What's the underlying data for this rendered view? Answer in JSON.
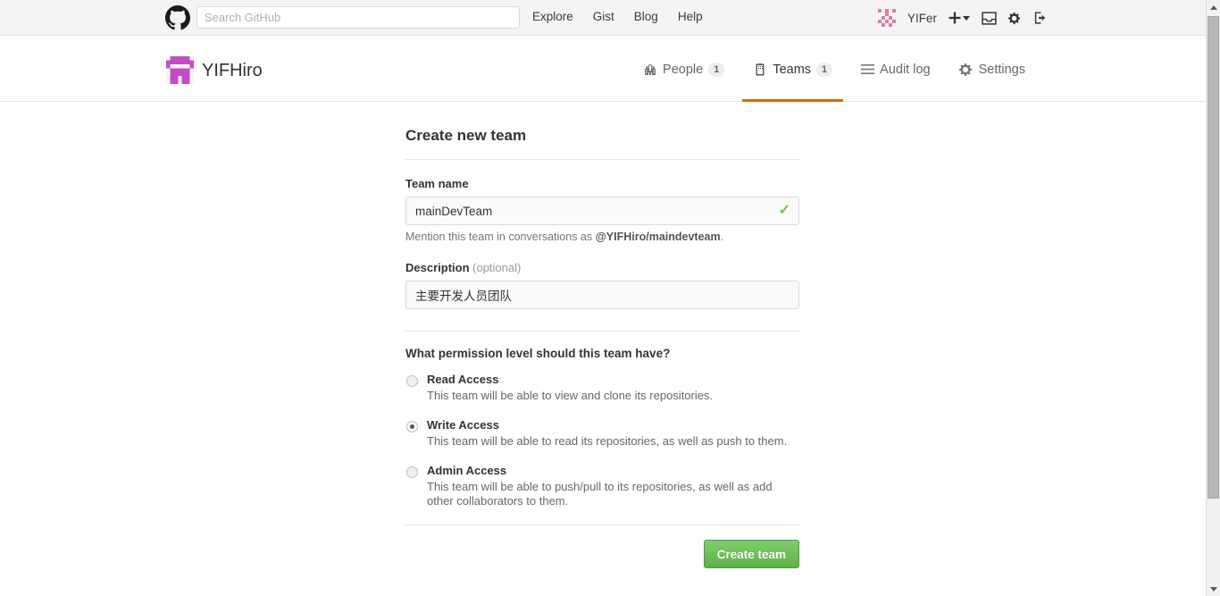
{
  "site_header": {
    "logo_icon": "github-mark-icon",
    "search": {
      "placeholder": "Search GitHub",
      "value": ""
    },
    "nav": [
      {
        "label": "Explore"
      },
      {
        "label": "Gist"
      },
      {
        "label": "Blog"
      },
      {
        "label": "Help"
      }
    ],
    "user": {
      "avatar_icon": "user-identicon-avatar",
      "name": "YIFer",
      "create_new_icon": "plus-icon",
      "create_new_caret_icon": "chevron-down-icon",
      "notifications_icon": "inbox-icon",
      "settings_icon": "gear-icon",
      "signout_icon": "sign-out-icon"
    }
  },
  "org_header": {
    "avatar_icon": "org-identicon-avatar",
    "name": "YIFHiro",
    "tabs": [
      {
        "label": "People",
        "icon": "organization-icon",
        "count": "1",
        "active": false
      },
      {
        "label": "Teams",
        "icon": "jersey-icon",
        "count": "1",
        "active": true
      },
      {
        "label": "Audit log",
        "icon": "list-icon",
        "count": "",
        "active": false
      },
      {
        "label": "Settings",
        "icon": "gear-icon",
        "count": "",
        "active": false
      }
    ]
  },
  "main": {
    "title": "Create new team",
    "team_name": {
      "label": "Team name",
      "value": "mainDevTeam",
      "placeholder": "",
      "valid_icon": "check-icon",
      "help_prefix": "Mention this team in conversations as ",
      "help_handle": "@YIFHiro/maindevteam",
      "help_suffix": "."
    },
    "description": {
      "label": "Description",
      "optional_note": "(optional)",
      "value": "主要开发人员团队",
      "placeholder": ""
    },
    "permission": {
      "question": "What permission level should this team have?",
      "options": [
        {
          "label": "Read Access",
          "description": "This team will be able to view and clone its repositories.",
          "selected": false
        },
        {
          "label": "Write Access",
          "description": "This team will be able to read its repositories, as well as push to them.",
          "selected": true
        },
        {
          "label": "Admin Access",
          "description": "This team will be able to push/pull to its repositories, as well as add other collaborators to them.",
          "selected": false
        }
      ]
    },
    "submit_label": "Create team"
  },
  "scrollbar": {
    "up_icon": "triangle-up-icon",
    "down_icon": "triangle-down-icon"
  },
  "colors": {
    "accent_orange": "#d26911",
    "button_green": "#5eb04a",
    "check_green": "#6cc644",
    "org_avatar": "#c44bc4",
    "user_avatar": "#e5799f",
    "header_bg": "#f4f4f4",
    "border": "#e5e5e5"
  }
}
